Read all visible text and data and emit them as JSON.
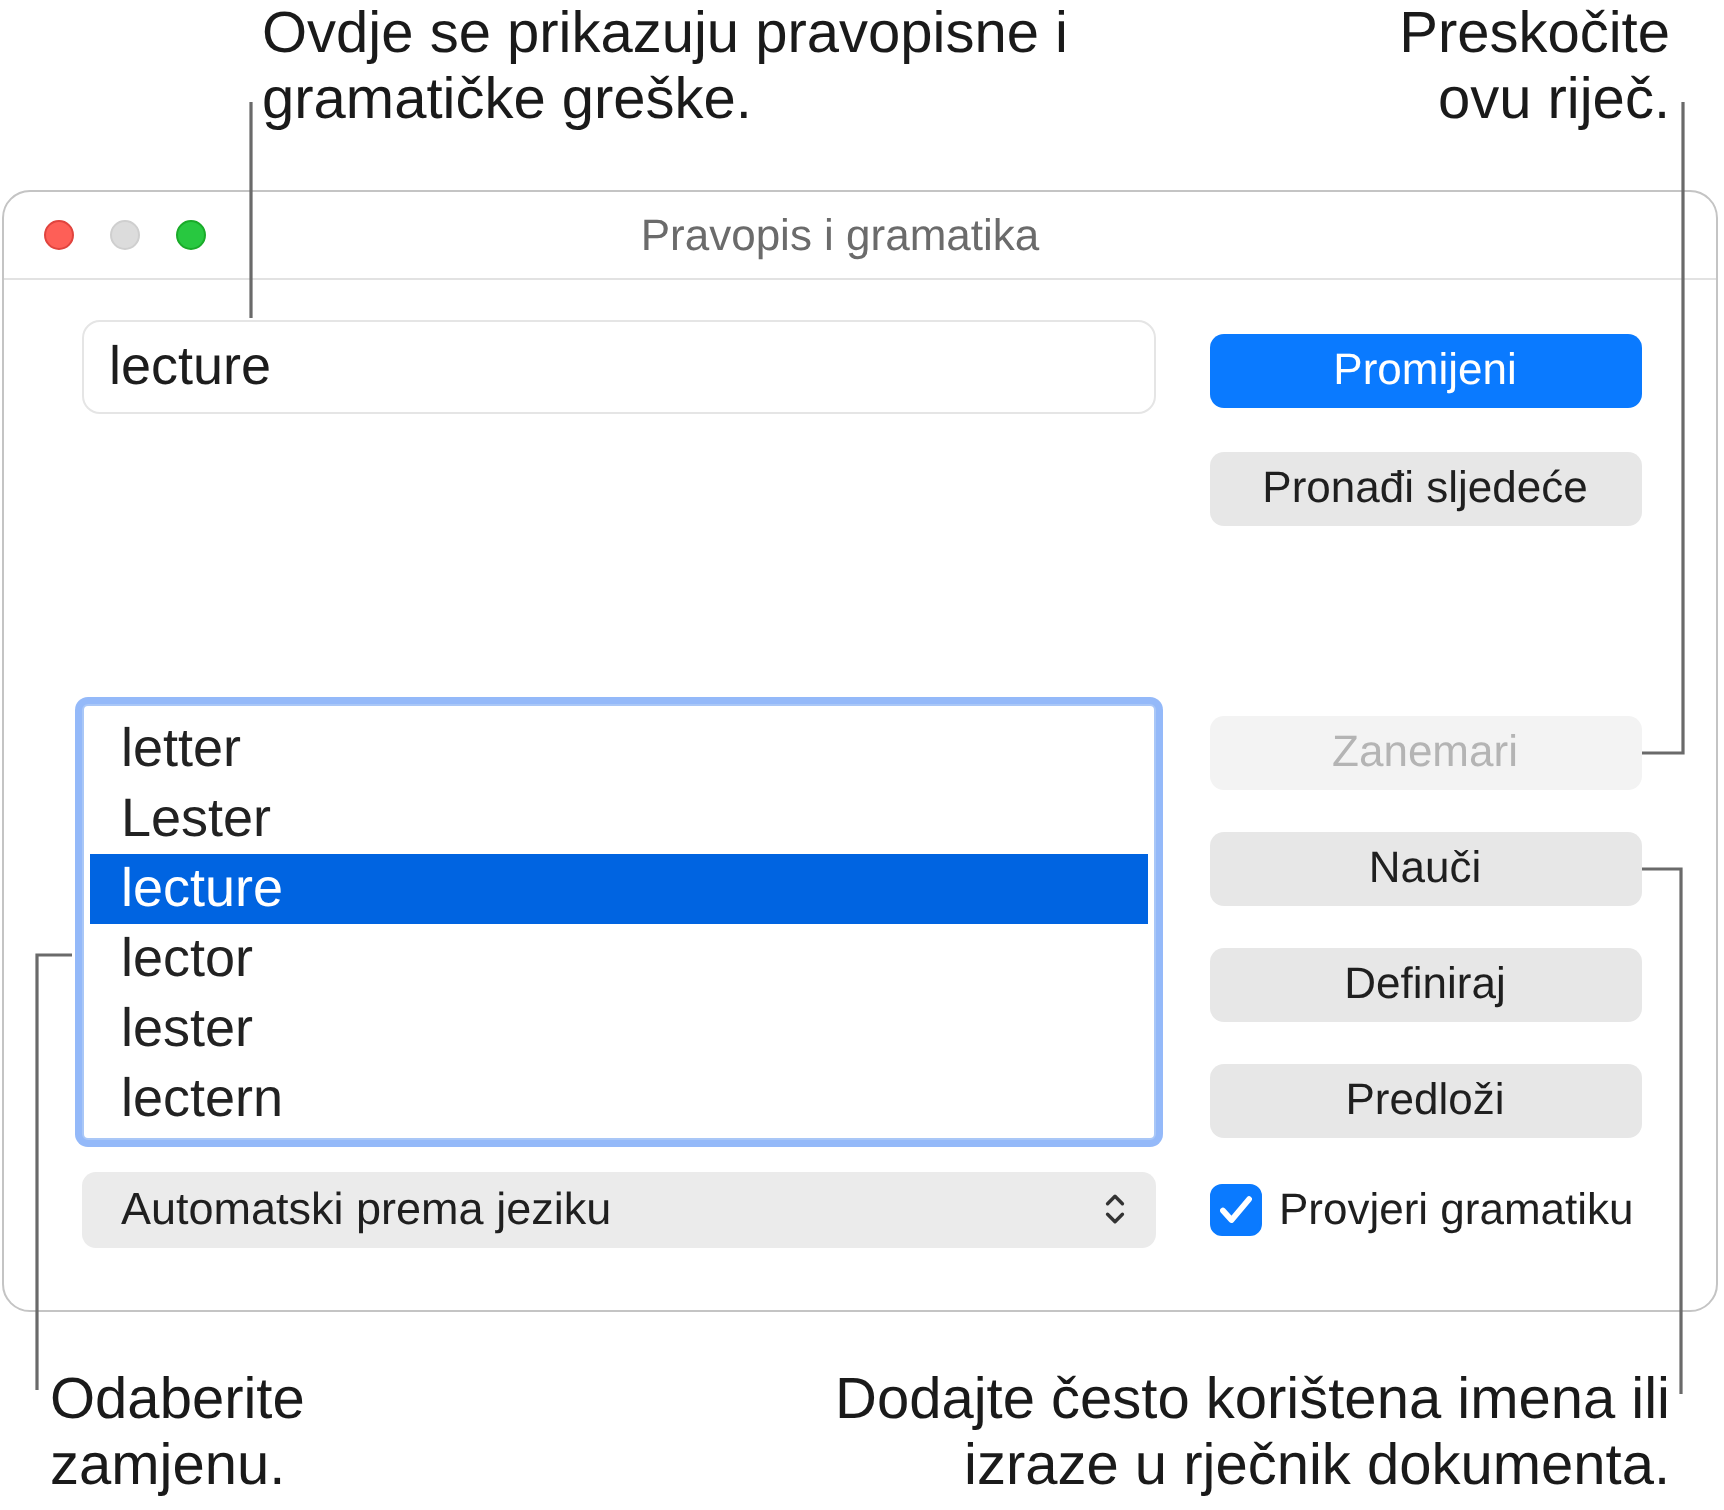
{
  "callouts": {
    "top_left": {
      "lines": [
        "Ovdje se prikazuju pravopisne i",
        "gramatičke greške."
      ]
    },
    "top_right": {
      "lines": [
        "Preskočite",
        "ovu riječ."
      ]
    },
    "bottom_left": {
      "lines": [
        "Odaberite",
        "zamjenu."
      ]
    },
    "bottom_right": {
      "lines": [
        "Dodajte često korištena imena ili",
        "izraze u rječnik dokumenta."
      ]
    }
  },
  "window": {
    "title": "Pravopis i gramatika",
    "controls": [
      {
        "kind": "close",
        "disabled": false
      },
      {
        "kind": "minimize",
        "disabled": true
      },
      {
        "kind": "zoom",
        "disabled": false
      }
    ]
  },
  "word_field": {
    "value": "lecture"
  },
  "top_buttons": [
    {
      "label": "Promijeni",
      "kind": "default",
      "disabled": false
    },
    {
      "label": "Pronađi sljedeće",
      "kind": "normal",
      "disabled": false
    }
  ],
  "suggestions": [
    {
      "text": "letter",
      "selected": false
    },
    {
      "text": "Lester",
      "selected": false
    },
    {
      "text": "lecture",
      "selected": true
    },
    {
      "text": "lector",
      "selected": false
    },
    {
      "text": "lester",
      "selected": false
    },
    {
      "text": "lectern",
      "selected": false
    }
  ],
  "side_buttons": [
    {
      "label": "Zanemari",
      "kind": "normal",
      "disabled": true
    },
    {
      "label": "Nauči",
      "kind": "normal",
      "disabled": false
    },
    {
      "label": "Definiraj",
      "kind": "normal",
      "disabled": false
    },
    {
      "label": "Predloži",
      "kind": "normal",
      "disabled": false
    }
  ],
  "language_menu": {
    "value": "Automatski prema jeziku"
  },
  "grammar_checkbox": {
    "label": "Provjeri gramatiku",
    "checked": true
  }
}
